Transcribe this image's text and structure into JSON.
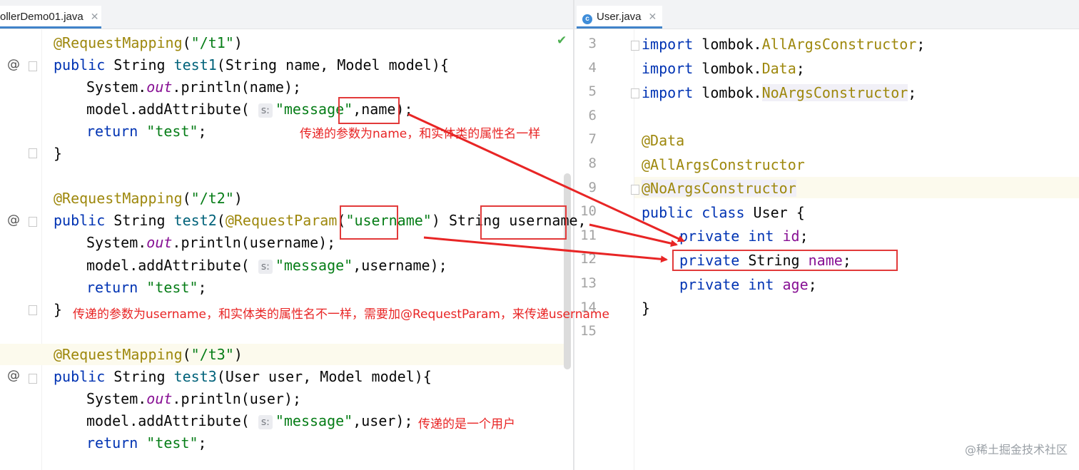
{
  "left_tab": {
    "label": "ollerDemo01.java",
    "close": "✕"
  },
  "right_tab": {
    "icon": "c",
    "label": "User.java",
    "close": "✕"
  },
  "left_code": [
    "@RequestMapping(\"/t1\")",
    "public String test1(String name, Model model){",
    "System.out.println(name);",
    "model.addAttribute(",
    "return \"test\";",
    "}",
    "@RequestMapping(\"/t2\")",
    "public String test2(@RequestParam(\"username\") String username,",
    "System.out.println(username);",
    "model.addAttribute(",
    "return \"test\";",
    "}",
    "@RequestMapping(\"/t3\")",
    "public String test3(User user, Model model){",
    "System.out.println(user);",
    "model.addAttribute(",
    "return \"test\";"
  ],
  "param_hint": "s:",
  "right_lines": [
    {
      "num": "3",
      "text": "import lombok.AllArgsConstructor;"
    },
    {
      "num": "4",
      "text": "import lombok.Data;"
    },
    {
      "num": "5",
      "text": "import lombok.NoArgsConstructor;"
    },
    {
      "num": "6",
      "text": ""
    },
    {
      "num": "7",
      "text": "@Data"
    },
    {
      "num": "8",
      "text": "@AllArgsConstructor"
    },
    {
      "num": "9",
      "text": "@NoArgsConstructor"
    },
    {
      "num": "10",
      "text": "public class User {"
    },
    {
      "num": "11",
      "text": "private int id;"
    },
    {
      "num": "12",
      "text": "private String name;"
    },
    {
      "num": "13",
      "text": "private int age;"
    },
    {
      "num": "14",
      "text": "}"
    },
    {
      "num": "15",
      "text": ""
    }
  ],
  "notes": {
    "n1": "传递的参数为name，和实体类的属性名一样",
    "n2": "传递的参数为username，和实体类的属性名不一样，需要加@RequestParam，来传递username",
    "n3": "传递的是一个用户"
  },
  "watermark": "@稀土掘金技术社区",
  "colors": {
    "annotation_red": "#e82525",
    "keyword": "#0033b3",
    "string": "#067d17",
    "annotation": "#9e880d"
  }
}
